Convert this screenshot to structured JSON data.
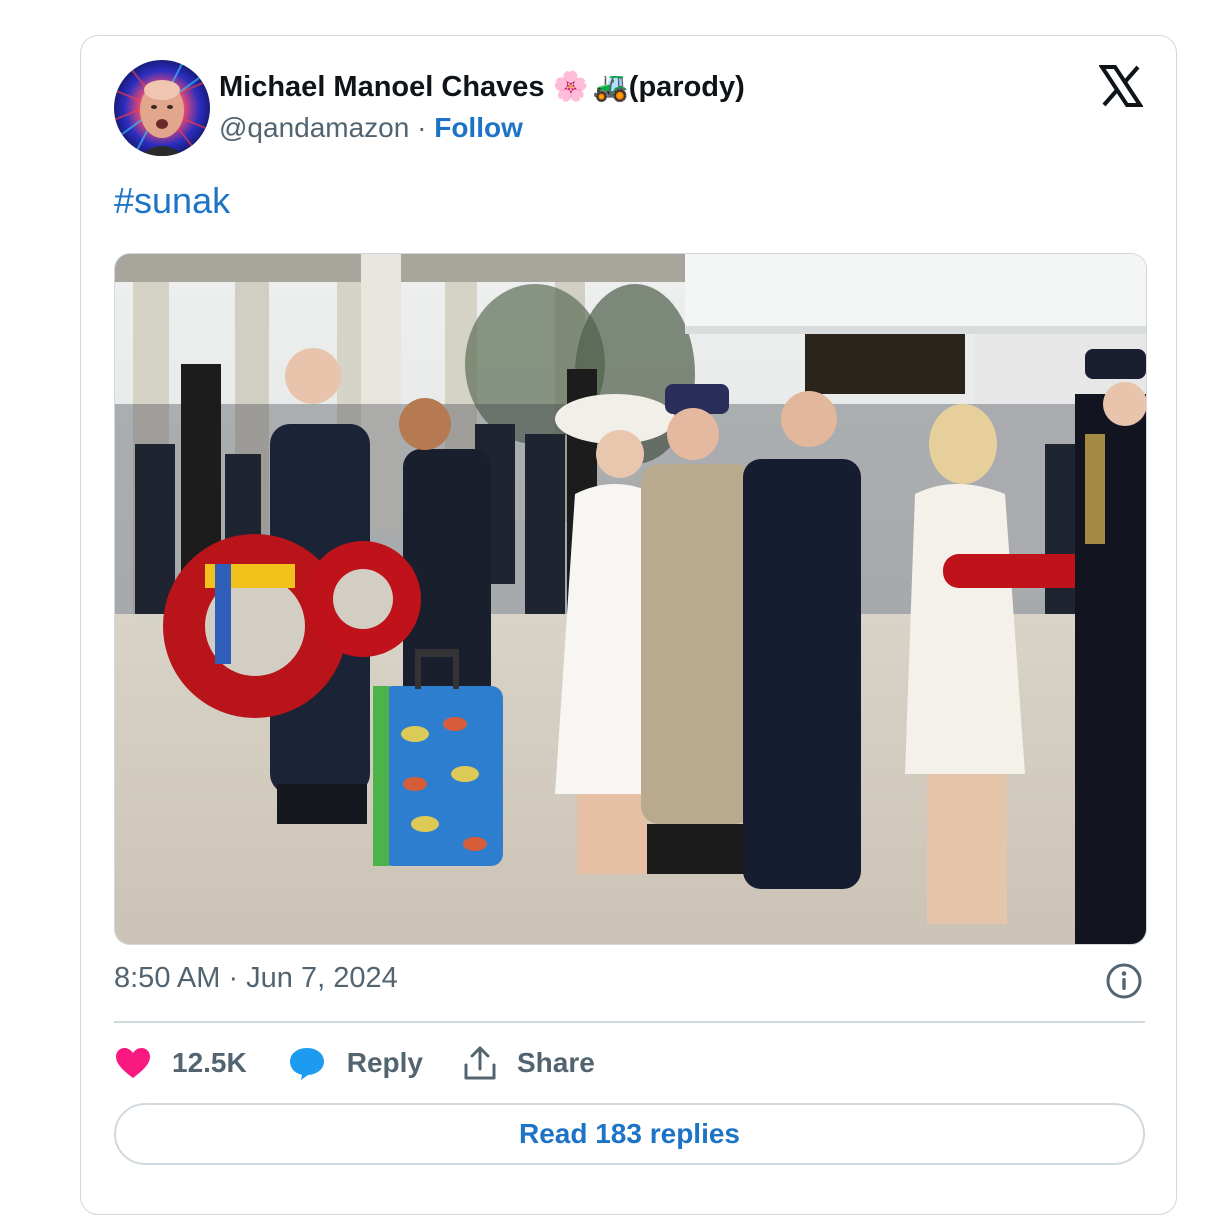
{
  "author": {
    "display_name": "Michael Manoel Chaves",
    "emoji_1": "🌸",
    "emoji_2": "🚜",
    "suffix": "(parody)",
    "handle": "@qandamazon",
    "separator": " · ",
    "follow_label": "Follow"
  },
  "tweet": {
    "hashtag": "#sunak",
    "timestamp": "8:50 AM · Jun 7, 2024",
    "photo_alt": "photo"
  },
  "actions": {
    "likes": "12.5K",
    "reply_label": "Reply",
    "share_label": "Share"
  },
  "read_replies_label": "Read 183 replies",
  "icons": {
    "logo": "x-logo-icon",
    "info": "info-icon",
    "like": "heart-icon",
    "reply": "speech-bubble-icon",
    "share": "share-upload-icon"
  },
  "colors": {
    "link": "#1d73c6",
    "heart": "#f91880",
    "reply_bubble": "#1d9bf0",
    "secondary_text": "#536471",
    "border": "#cfd9de"
  }
}
